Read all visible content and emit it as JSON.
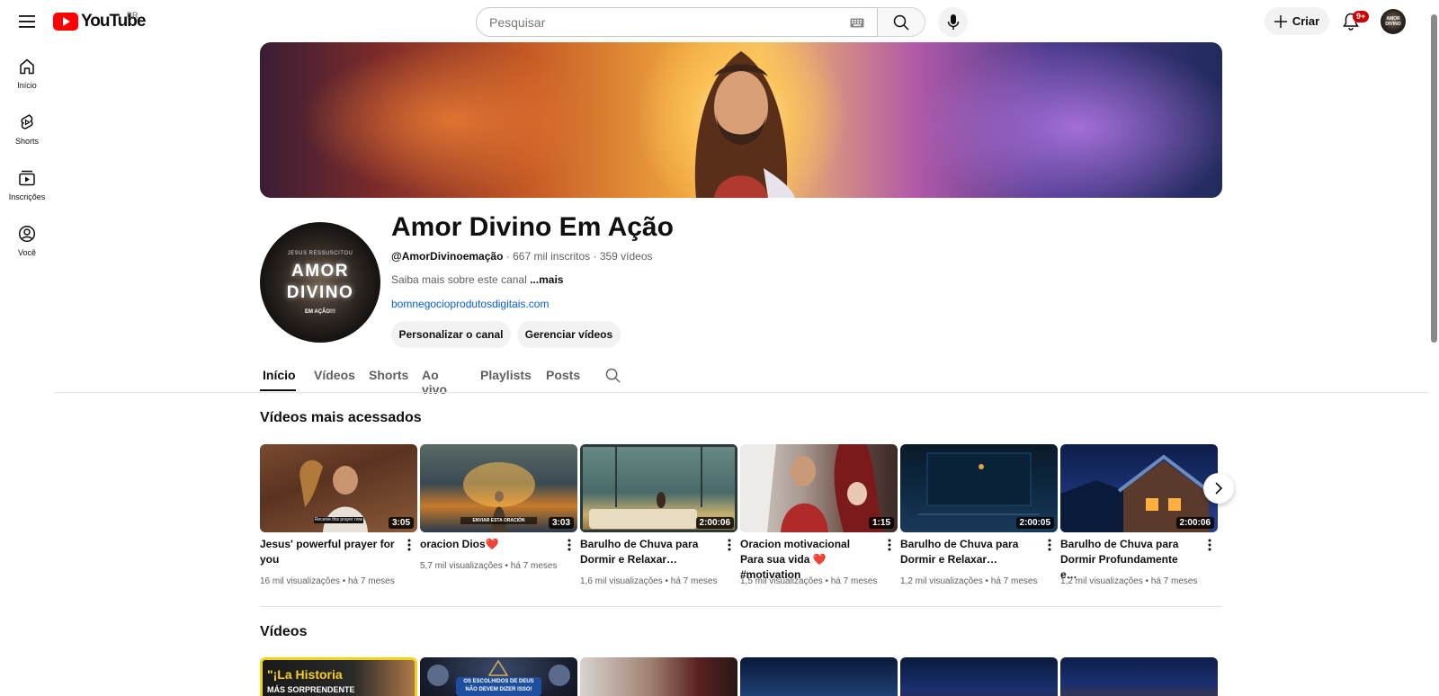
{
  "header": {
    "logo_text": "YouTube",
    "region": "BR",
    "search_placeholder": "Pesquisar",
    "create_label": "Criar",
    "notification_count": "9+",
    "avatar_text": "AMOR DIVINO"
  },
  "sidebar": {
    "items": [
      {
        "label": "Início",
        "icon": "home-icon"
      },
      {
        "label": "Shorts",
        "icon": "shorts-icon"
      },
      {
        "label": "Inscrições",
        "icon": "subscriptions-icon"
      },
      {
        "label": "Você",
        "icon": "you-icon"
      }
    ]
  },
  "channel": {
    "name": "Amor Divino Em Ação",
    "handle": "@AmorDivinoemação",
    "subscribers": "667 mil inscritos",
    "videos_count": "359 vídeos",
    "about_prefix": "Saiba mais sobre este canal ",
    "about_more": "...mais",
    "link": "bomnegocioprodutosdigitais.com",
    "customize_label": "Personalizar o canal",
    "manage_label": "Gerenciar vídeos",
    "avatar_top": "JESUS RESSUSCITOU",
    "avatar_line1": "AMOR",
    "avatar_line2": "DIVINO",
    "avatar_bottom": "EM AÇÃO!!!"
  },
  "tabs": [
    {
      "label": "Início",
      "active": true
    },
    {
      "label": "Vídeos",
      "active": false
    },
    {
      "label": "Shorts",
      "active": false
    },
    {
      "label": "Ao vivo",
      "active": false
    },
    {
      "label": "Playlists",
      "active": false
    },
    {
      "label": "Posts",
      "active": false
    }
  ],
  "popular": {
    "title": "Vídeos mais acessados",
    "videos": [
      {
        "title": "Jesus' powerful prayer for you",
        "duration": "3:05",
        "views": "16 mil visualizações",
        "age": "há 7 meses",
        "thumb_caption": "Receive this prayer now"
      },
      {
        "title": "oracion Dios❤️",
        "duration": "3:03",
        "views": "5,7 mil visualizações",
        "age": "há 7 meses",
        "thumb_caption": "ENVIAR ESTA ORACIÓN"
      },
      {
        "title": "Barulho de Chuva para Dormir e Relaxar…",
        "duration": "2:00:06",
        "views": "1,6 mil visualizações",
        "age": "há 7 meses"
      },
      {
        "title": "Oracion motivacional Para sua vida ❤️ #motivation",
        "duration": "1:15",
        "views": "1,5 mil visualizações",
        "age": "há 7 meses"
      },
      {
        "title": "Barulho de Chuva para Dormir e Relaxar…",
        "duration": "2:00:05",
        "views": "1,2 mil visualizações",
        "age": "há 7 meses"
      },
      {
        "title": "Barulho de Chuva para Dormir Profundamente e…",
        "duration": "2:00:06",
        "views": "1,2 mil visualizações",
        "age": "há 7 meses"
      }
    ]
  },
  "videos_section": {
    "title": "Vídeos",
    "thumb1_line1": "\"¡La Historia",
    "thumb1_line2": "MÁS SORPRENDENTE",
    "thumb2_line1": "OS ESCOLHIDOS DE DEUS",
    "thumb2_line2": "NÃO DEVEM DIZER ISSO!"
  },
  "colors": {
    "brand_red": "#ff0000",
    "link_blue": "#065fd4",
    "badge_red": "#cc0000"
  }
}
